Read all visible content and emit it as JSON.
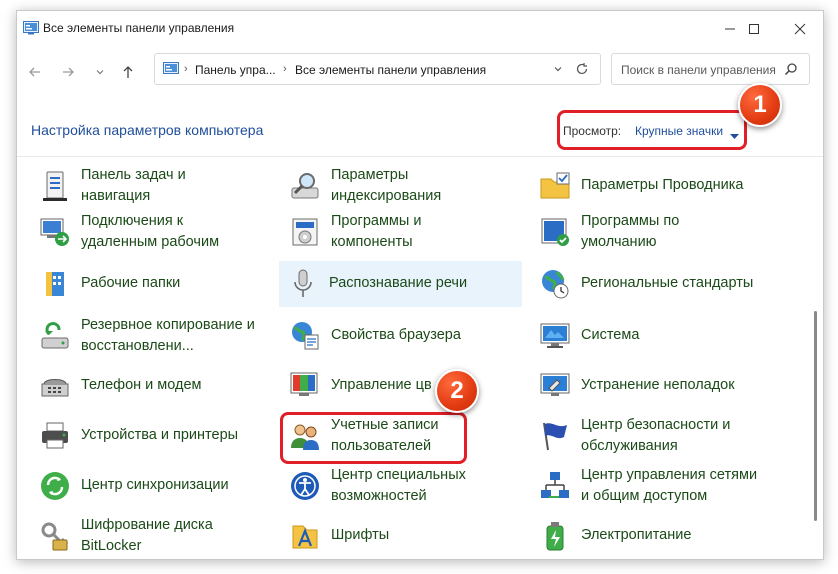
{
  "window": {
    "title": "Все элементы панели управления",
    "controls": [
      "minimize-icon",
      "maximize-icon",
      "close-icon"
    ]
  },
  "address": {
    "crumbs": [
      "Панель упра...",
      "Все элементы панели управления"
    ],
    "icon": "control-panel-icon"
  },
  "search": {
    "placeholder": "Поиск в панели управления"
  },
  "header": {
    "title": "Настройка параметров компьютера",
    "view_label": "Просмотр:",
    "view_value": "Крупные значки"
  },
  "annotations": {
    "badge1": "1",
    "badge2": "2"
  },
  "items": [
    {
      "lines": [
        "Панель задач и",
        "навигация"
      ],
      "icon": "taskbar-icon"
    },
    {
      "lines": [
        "Параметры",
        "индексирования"
      ],
      "icon": "indexing-icon"
    },
    {
      "lines": [
        "Параметры Проводника"
      ],
      "icon": "folder-options-icon"
    },
    {
      "lines": [
        "Подключения к",
        "удаленным рабочим"
      ],
      "icon": "remote-desktop-icon"
    },
    {
      "lines": [
        "Программы и",
        "компоненты"
      ],
      "icon": "programs-icon"
    },
    {
      "lines": [
        "Программы по",
        "умолчанию"
      ],
      "icon": "default-programs-icon"
    },
    {
      "lines": [
        "Рабочие папки"
      ],
      "icon": "work-folders-icon"
    },
    {
      "lines": [
        "Распознавание речи"
      ],
      "icon": "microphone-icon"
    },
    {
      "lines": [
        "Региональные стандарты"
      ],
      "icon": "region-icon"
    },
    {
      "lines": [
        "Резервное копирование и",
        "восстановлени..."
      ],
      "icon": "backup-icon"
    },
    {
      "lines": [
        "Свойства браузера"
      ],
      "icon": "internet-options-icon"
    },
    {
      "lines": [
        "Система"
      ],
      "icon": "system-icon"
    },
    {
      "lines": [
        "Телефон и модем"
      ],
      "icon": "phone-modem-icon"
    },
    {
      "lines": [
        "Управление цв"
      ],
      "icon": "color-management-icon"
    },
    {
      "lines": [
        "Устранение неполадок"
      ],
      "icon": "troubleshooting-icon"
    },
    {
      "lines": [
        "Устройства и принтеры"
      ],
      "icon": "devices-printers-icon"
    },
    {
      "lines": [
        "Учетные записи",
        "пользователей"
      ],
      "icon": "user-accounts-icon"
    },
    {
      "lines": [
        "Центр безопасности и",
        "обслуживания"
      ],
      "icon": "security-flag-icon"
    },
    {
      "lines": [
        "Центр синхронизации"
      ],
      "icon": "sync-center-icon"
    },
    {
      "lines": [
        "Центр специальных",
        "возможностей"
      ],
      "icon": "accessibility-icon"
    },
    {
      "lines": [
        "Центр управления сетями",
        "и общим доступом"
      ],
      "icon": "network-center-icon"
    },
    {
      "lines": [
        "Шифрование диска",
        "BitLocker"
      ],
      "icon": "bitlocker-icon"
    },
    {
      "lines": [
        "Шрифты"
      ],
      "icon": "fonts-icon"
    },
    {
      "lines": [
        "Электропитание"
      ],
      "icon": "power-options-icon"
    }
  ]
}
